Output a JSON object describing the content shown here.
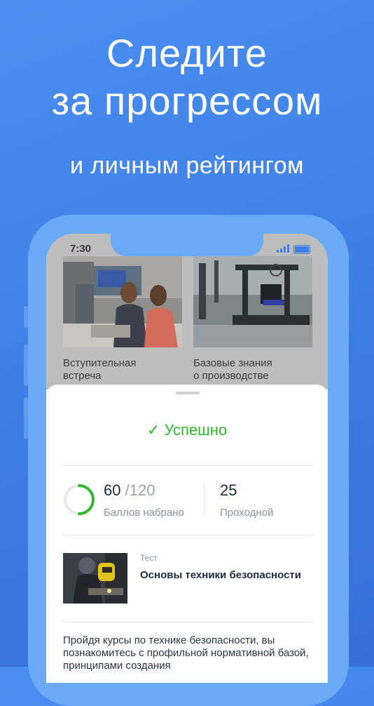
{
  "hero": {
    "title_line1": "Следите",
    "title_line2": "за прогрессом",
    "subtitle": "и личным рейтингом"
  },
  "status_bar": {
    "time": "7:30"
  },
  "cards": [
    {
      "title_line1": "Вступительная",
      "title_line2": "встреча"
    },
    {
      "title_line1": "Базовые знания",
      "title_line2": "о производстве"
    }
  ],
  "result": {
    "status": "Успешно",
    "score": "60",
    "max_score": "120",
    "score_separator": "/",
    "score_label": "Баллов набрано",
    "score_fraction": 0.5,
    "passing_score": "25",
    "passing_label": "Проходной"
  },
  "test": {
    "category": "Тест",
    "title": "Основы техники безопасности"
  },
  "description": "Пройдя курсы по технике безопасности, вы познакомитесь с профильной нормативной базой, принципами создания",
  "colors": {
    "background": "#4286ea",
    "phone_frame": "#6aa9f5",
    "success": "#2dbb2d",
    "progress_track": "#e6e8eb",
    "text_dark": "#1f2a3a",
    "text_muted": "#8a939c"
  },
  "icons": {
    "success": "check-icon",
    "signal": "signal-icon",
    "battery": "battery-icon"
  }
}
